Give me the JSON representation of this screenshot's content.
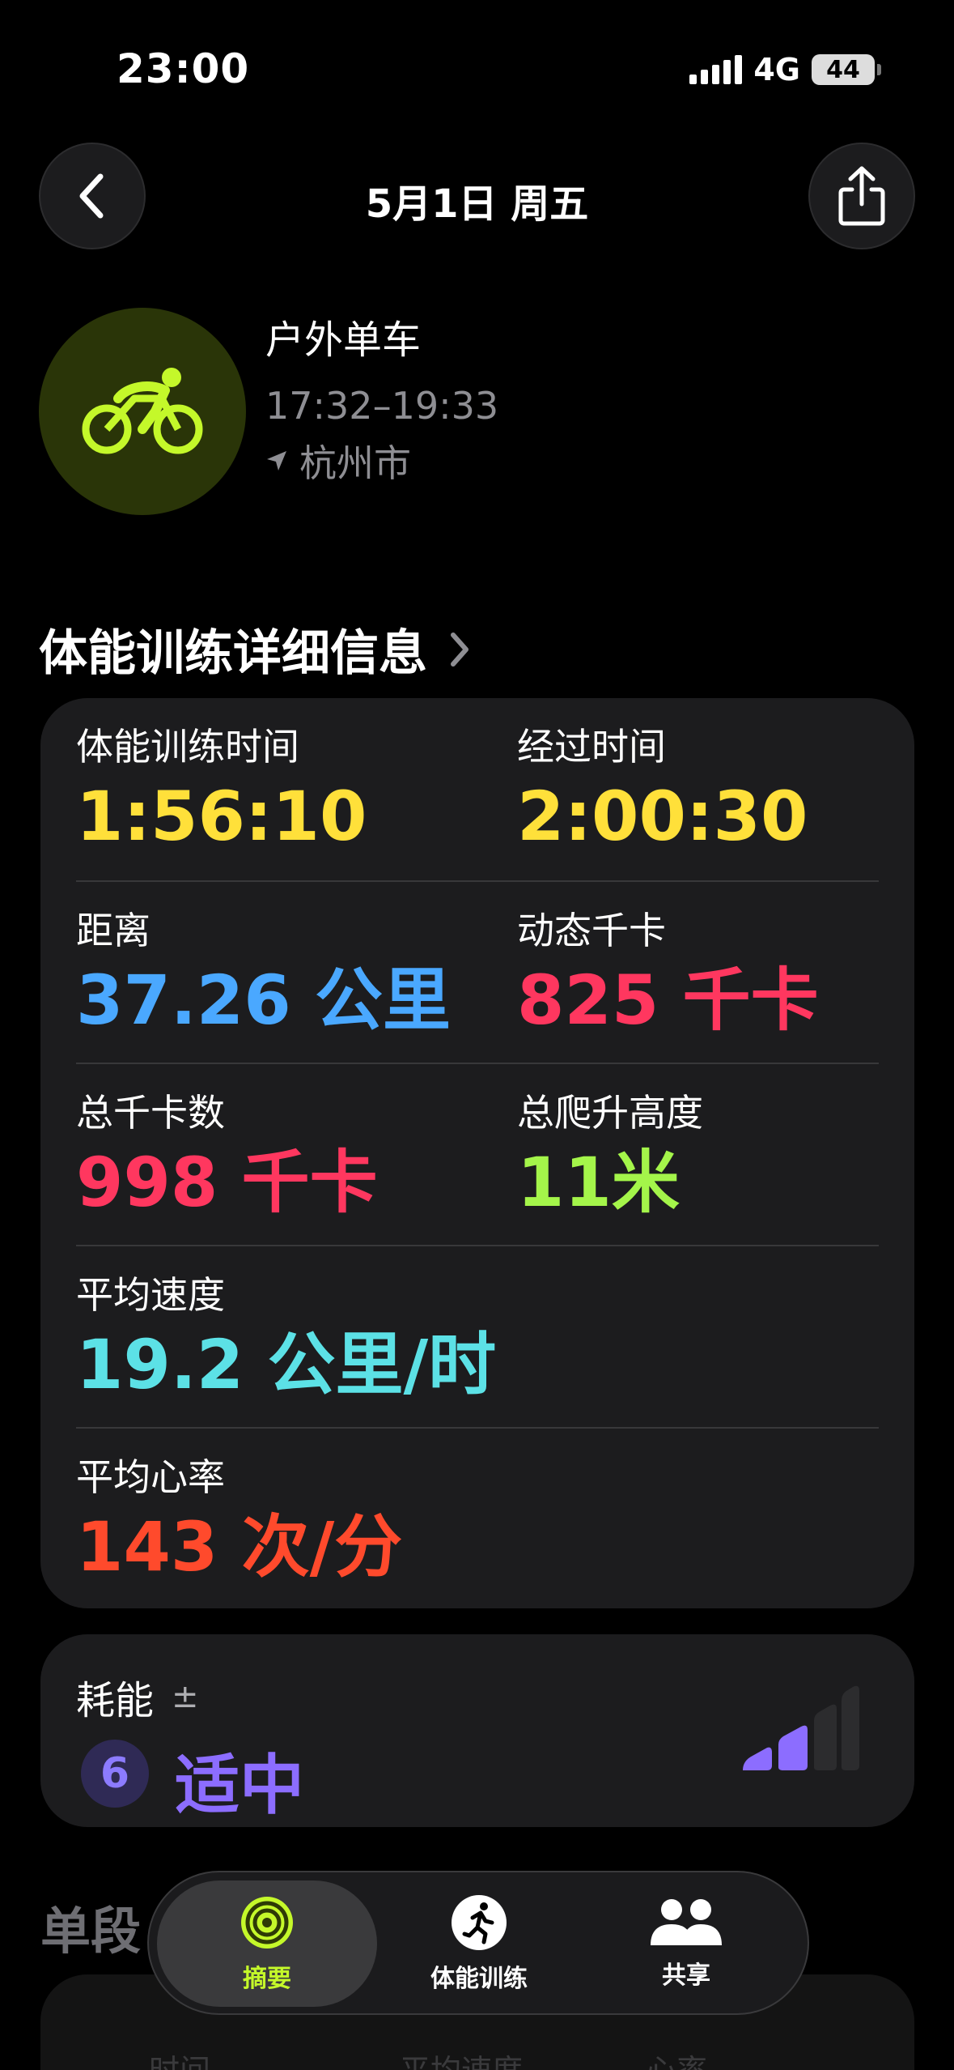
{
  "status_bar": {
    "time": "23:00",
    "network": "4G",
    "battery": "44"
  },
  "nav": {
    "title": "5月1日 周五"
  },
  "workout": {
    "name": "户外单车",
    "time_range": "17:32–19:33",
    "location": "杭州市"
  },
  "section_title": "体能训练详细信息",
  "metrics": {
    "workout_time_label": "体能训练时间",
    "workout_time_value": "1:56:10",
    "elapsed_label": "经过时间",
    "elapsed_value": "2:00:30",
    "distance_label": "距离",
    "distance_value": "37.26 公里",
    "active_cal_label": "动态千卡",
    "active_cal_value": "825 千卡",
    "total_cal_label": "总千卡数",
    "total_cal_value": "998 千卡",
    "elevation_label": "总爬升高度",
    "elevation_value": "11米",
    "avg_speed_label": "平均速度",
    "avg_speed_value": "19.2 公里/时",
    "avg_hr_label": "平均心率",
    "avg_hr_value": "143 次/分"
  },
  "effort": {
    "label": "耗能",
    "adjust_symbol": "±",
    "score": "6",
    "level": "适中"
  },
  "segments": {
    "title": "单段",
    "columns": [
      "时间",
      "平均速度",
      "心率"
    ]
  },
  "tab_bar": {
    "summary": "摘要",
    "workouts": "体能训练",
    "sharing": "共享"
  },
  "colors": {
    "activity_green": "#c4f82a",
    "yellow": "#ffe03a",
    "blue": "#4aa8ff",
    "red": "#ff375f",
    "green": "#a4f54a",
    "cyan": "#5ce1e6",
    "orange": "#ff4a2c",
    "purple": "#8c6dff"
  }
}
